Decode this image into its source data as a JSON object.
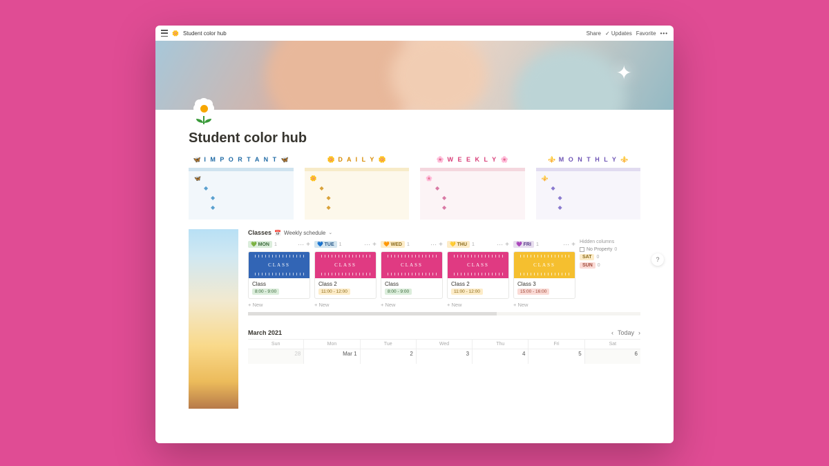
{
  "topbar": {
    "breadcrumb_icon": "🌼",
    "breadcrumb": "Student color hub",
    "share": "Share",
    "updates": "Updates",
    "favorite": "Favorite"
  },
  "page": {
    "title": "Student color hub"
  },
  "blocks": [
    {
      "label": "I M P O R T A N T",
      "deco": "🦋",
      "variant": "b-blue",
      "bullet_color": "#5aa0cf",
      "icon": "🦋"
    },
    {
      "label": "D A I L Y",
      "deco": "🌼",
      "variant": "b-yel",
      "bullet_color": "#d9a23a",
      "icon": "🌼"
    },
    {
      "label": "W E E K L Y",
      "deco": "🌸",
      "variant": "b-pink",
      "bullet_color": "#d97aa5",
      "icon": "🌸"
    },
    {
      "label": "M O N T H L Y",
      "deco": "⚜️",
      "variant": "b-pur",
      "bullet_color": "#8a7acf",
      "icon": "⚜️"
    }
  ],
  "classes": {
    "title": "Classes",
    "view_icon": "📅",
    "view_label": "Weekly schedule",
    "hidden_label": "Hidden columns",
    "noprop": "No Property",
    "noprop_count": "0",
    "extras": [
      {
        "tag": "SAT",
        "cls": "tag-sat",
        "count": "0"
      },
      {
        "tag": "SUN",
        "cls": "tag-sun",
        "count": "0"
      }
    ],
    "columns": [
      {
        "tag": "💚 MON",
        "tag_cls": "tag-mon",
        "count": "1",
        "card": {
          "cov_cls": "cc-blue",
          "cov_label": "CLASS",
          "title": "Class",
          "time": "8:00 - 9:00",
          "time_cls": "t-gr"
        }
      },
      {
        "tag": "💙 TUE",
        "tag_cls": "tag-tue",
        "count": "1",
        "card": {
          "cov_cls": "cc-pink",
          "cov_label": "CLASS",
          "title": "Class 2",
          "time": "11:00 - 12:00",
          "time_cls": "t-or"
        }
      },
      {
        "tag": "🧡 WED",
        "tag_cls": "tag-wed",
        "count": "1",
        "card": {
          "cov_cls": "cc-pink2",
          "cov_label": "CLASS",
          "title": "Class",
          "time": "8:00 - 9:00",
          "time_cls": "t-gr"
        }
      },
      {
        "tag": "💛 THU",
        "tag_cls": "tag-thu",
        "count": "1",
        "card": {
          "cov_cls": "cc-pink3",
          "cov_label": "CLASS",
          "title": "Class 2",
          "time": "11:00 - 12:00",
          "time_cls": "t-or"
        }
      },
      {
        "tag": "💜 FRI",
        "tag_cls": "tag-fri",
        "count": "1",
        "card": {
          "cov_cls": "cc-yel",
          "cov_label": "CLASS",
          "title": "Class 3",
          "time": "15:00 - 16:00",
          "time_cls": "t-pk"
        }
      }
    ],
    "new_label": "New"
  },
  "calendar": {
    "month": "March 2021",
    "today": "Today",
    "days": [
      "Sun",
      "Mon",
      "Tue",
      "Wed",
      "Thu",
      "Fri",
      "Sat"
    ],
    "row": [
      "28",
      "Mar 1",
      "2",
      "3",
      "4",
      "5",
      "6"
    ]
  },
  "help": "?"
}
